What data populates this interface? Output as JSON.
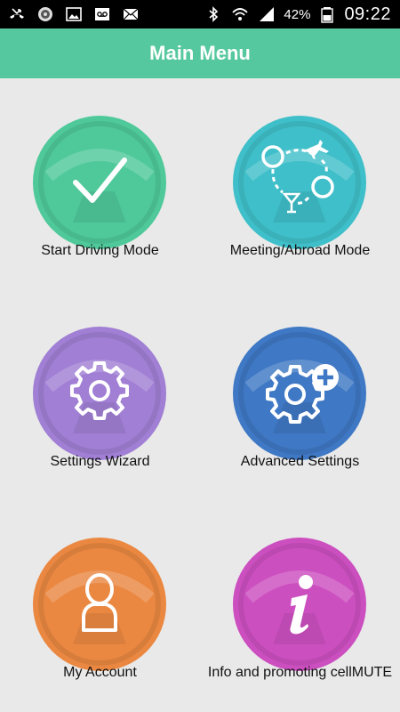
{
  "status_bar": {
    "battery_percent": "42%",
    "time": "09:22",
    "icons_left": [
      "missed-call-icon",
      "app-icon",
      "gallery-icon",
      "voicemail-icon",
      "email-icon"
    ],
    "icons_right": [
      "bluetooth-icon",
      "wifi-icon",
      "signal-icon",
      "battery-icon"
    ]
  },
  "header": {
    "title": "Main Menu"
  },
  "menu": {
    "items": [
      {
        "label": "Start Driving Mode",
        "color": "#4fc99a",
        "icon": "checkmark-icon"
      },
      {
        "label": "Meeting/Abroad Mode",
        "color": "#3fbfc9",
        "icon": "travel-icon"
      },
      {
        "label": "Settings Wizard",
        "color": "#a07fd4",
        "icon": "gear-icon"
      },
      {
        "label": "Advanced Settings",
        "color": "#3f78c4",
        "icon": "gear-plus-icon"
      },
      {
        "label": "My Account",
        "color": "#ea8842",
        "icon": "user-icon"
      },
      {
        "label": "Info and promoting cellMUTE",
        "color": "#cc4fc0",
        "icon": "info-icon"
      }
    ]
  }
}
